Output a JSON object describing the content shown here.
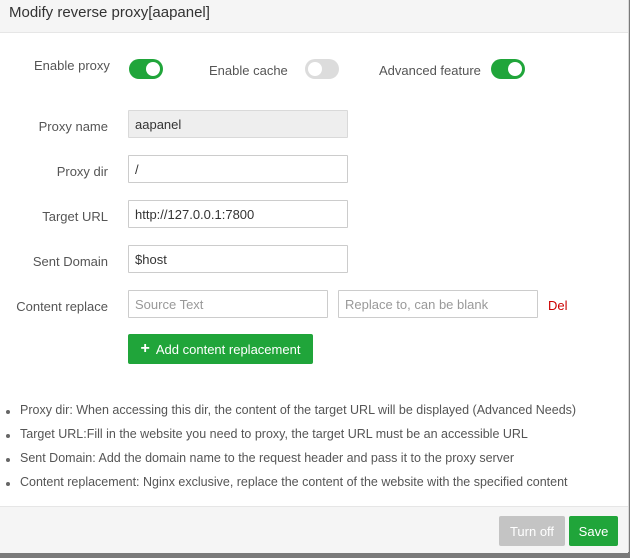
{
  "dialog": {
    "title": "Modify reverse proxy[aapanel]"
  },
  "toggles": {
    "enable_proxy": {
      "label": "Enable proxy",
      "on": true
    },
    "enable_cache": {
      "label": "Enable cache",
      "on": false
    },
    "advanced_feature": {
      "label": "Advanced feature",
      "on": true
    }
  },
  "form": {
    "proxy_name": {
      "label": "Proxy name",
      "value": "aapanel"
    },
    "proxy_dir": {
      "label": "Proxy dir",
      "value": "/"
    },
    "target_url": {
      "label": "Target URL",
      "value": "http://127.0.0.1:7800"
    },
    "sent_domain": {
      "label": "Sent Domain",
      "value": "$host"
    },
    "content_replace": {
      "label": "Content replace",
      "source_placeholder": "Source Text",
      "replace_placeholder": "Replace to, can be blank",
      "delete_label": "Del"
    },
    "add_label": "Add content replacement"
  },
  "tips": [
    "Proxy dir: When accessing this dir, the content of the target URL will be displayed (Advanced Needs)",
    "Target URL:Fill in the website you need to proxy, the target URL must be an accessible URL",
    "Sent Domain: Add the domain name to the request header and pass it to the proxy server",
    "Content replacement: Nginx exclusive, replace the content of the website with the specified content"
  ],
  "footer": {
    "turn_off_label": "Turn off",
    "save_label": "Save"
  },
  "colors": {
    "accent": "#20a53a",
    "danger": "#cc0000",
    "disabled_button": "#c4c4c4"
  }
}
